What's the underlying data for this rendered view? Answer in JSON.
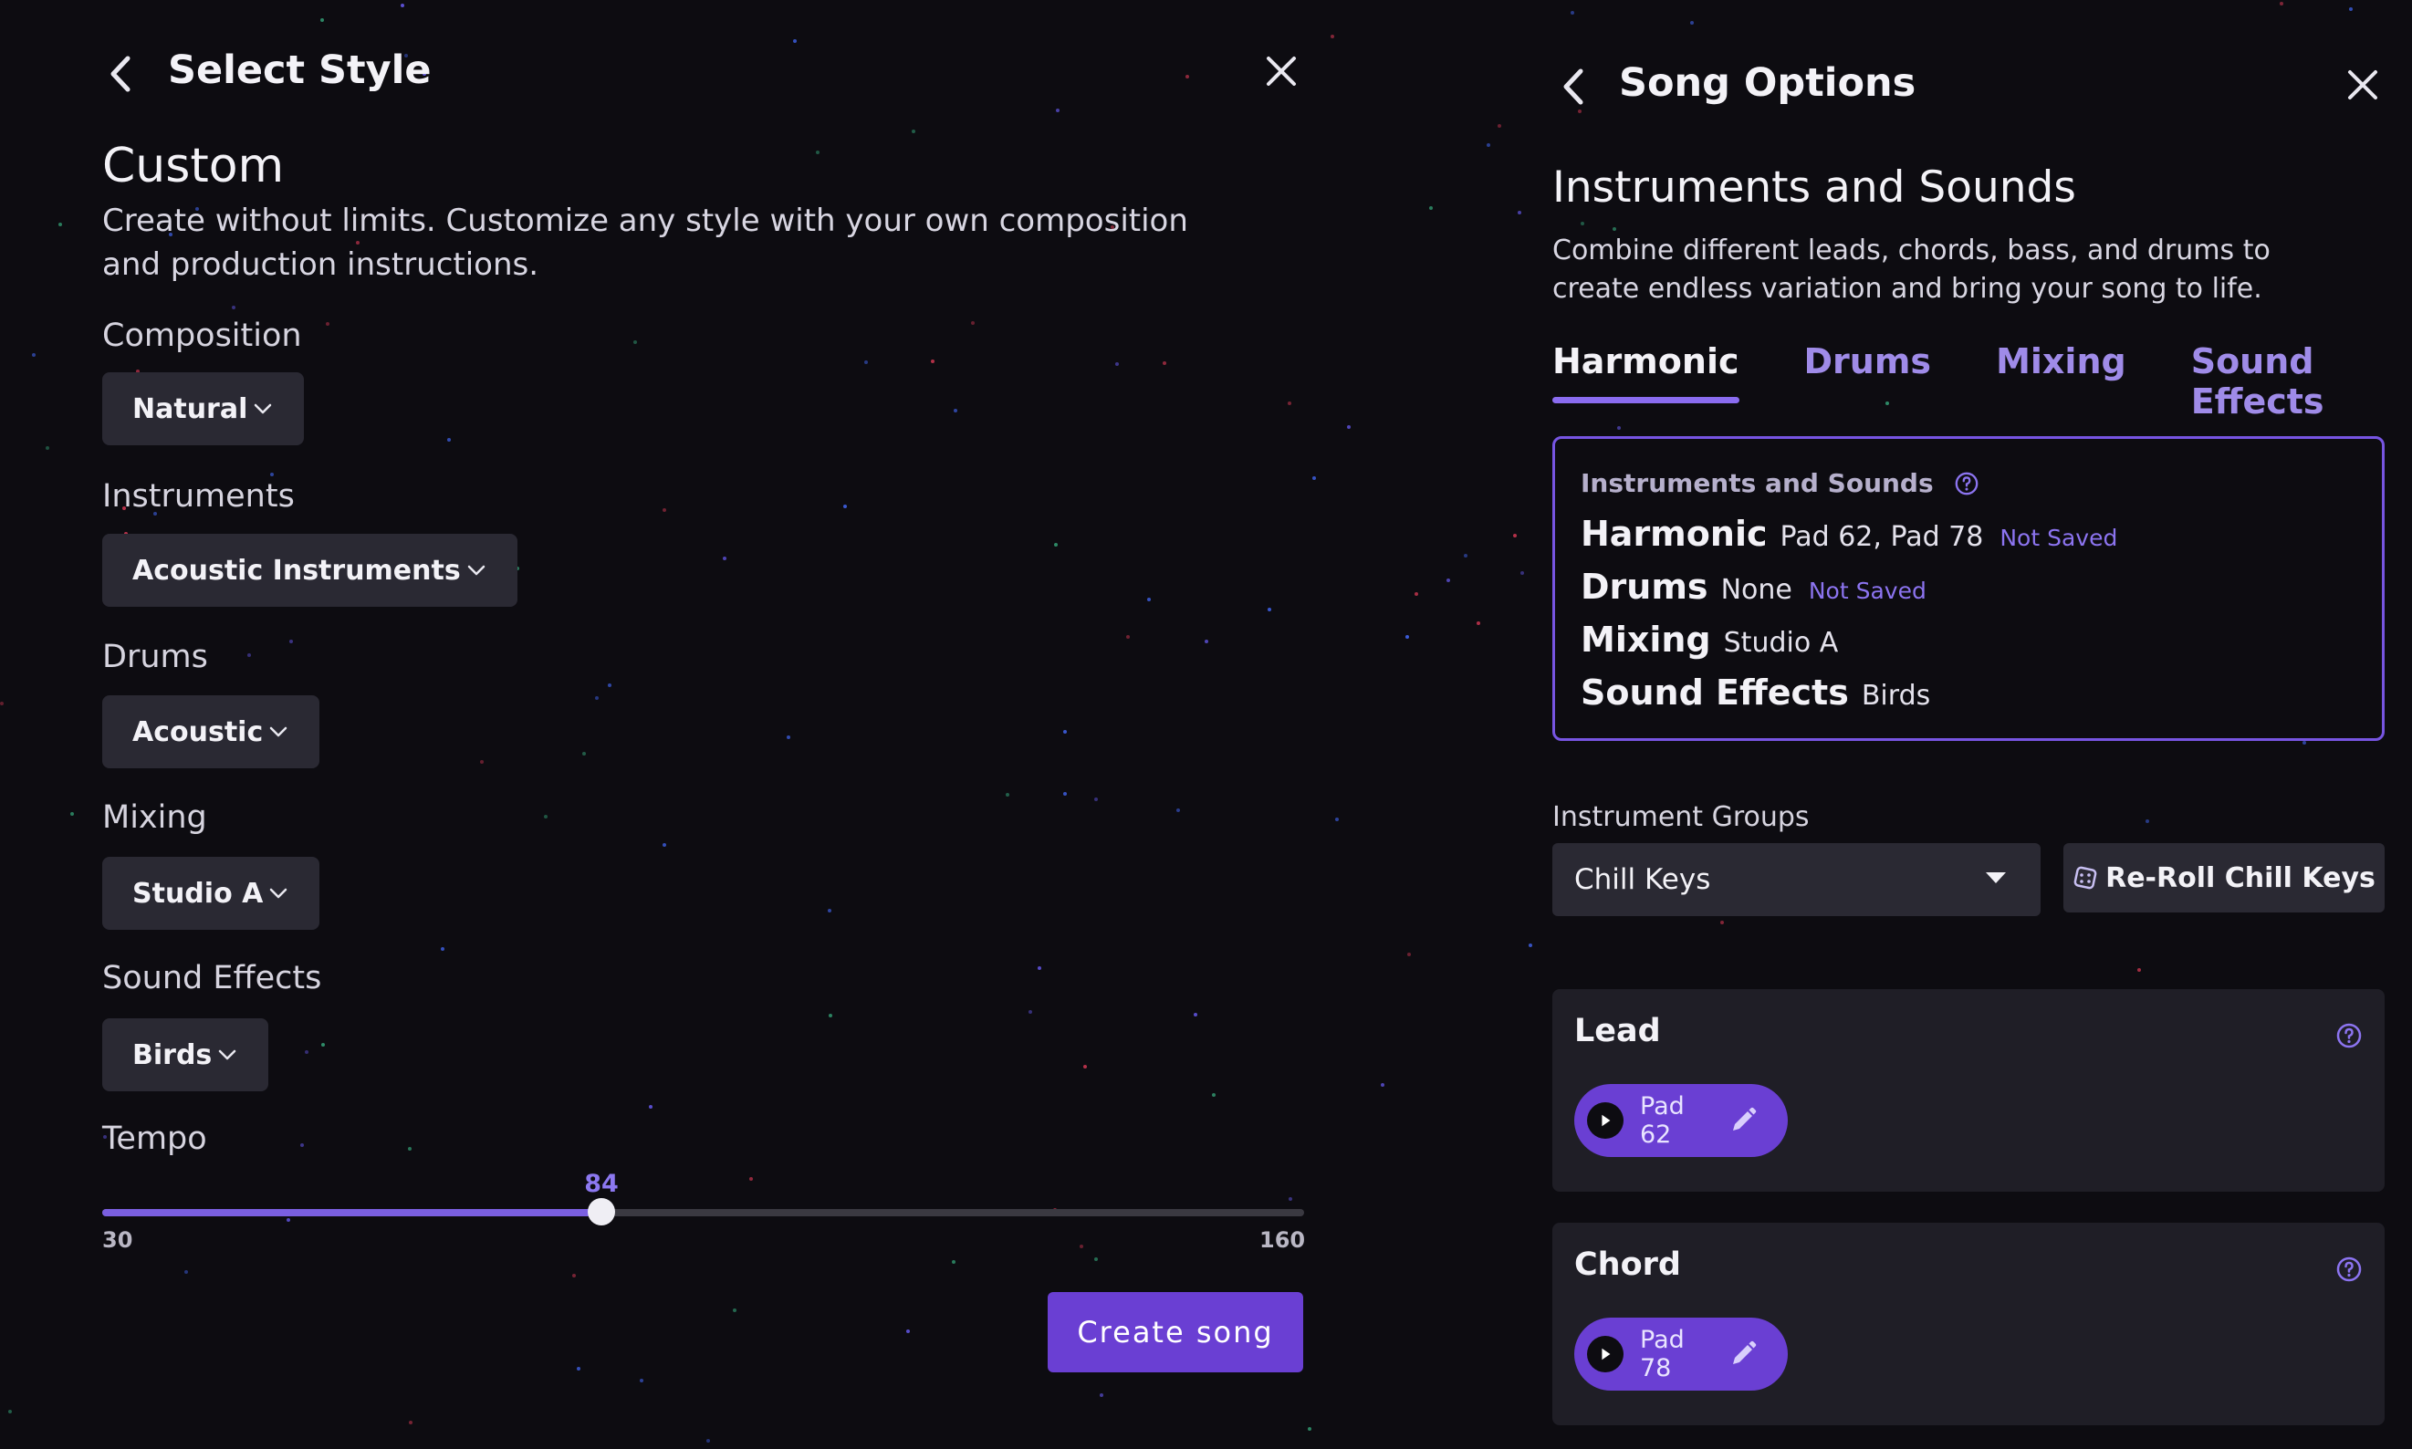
{
  "left_panel": {
    "title": "Select Style",
    "heading": "Custom",
    "description": "Create without limits. Customize any style with your own composition and production instructions.",
    "fields": {
      "composition": {
        "label": "Composition",
        "value": "Natural"
      },
      "instruments": {
        "label": "Instruments",
        "value": "Acoustic Instruments"
      },
      "drums": {
        "label": "Drums",
        "value": "Acoustic"
      },
      "mixing": {
        "label": "Mixing",
        "value": "Studio A"
      },
      "sound_effects": {
        "label": "Sound Effects",
        "value": "Birds"
      }
    },
    "tempo": {
      "label": "Tempo",
      "value": 84,
      "value_text": "84",
      "min": 30,
      "max": 160,
      "min_text": "30",
      "max_text": "160"
    },
    "create_button": "Create song"
  },
  "right_panel": {
    "title": "Song Options",
    "heading": "Instruments and Sounds",
    "description": "Combine different leads, chords, bass, and drums to create endless variation and bring your song to life.",
    "tabs": [
      {
        "label": "Harmonic",
        "active": true
      },
      {
        "label": "Drums",
        "active": false
      },
      {
        "label": "Mixing",
        "active": false
      },
      {
        "label": "Sound Effects",
        "active": false
      }
    ],
    "summary": {
      "heading": "Instruments and Sounds",
      "rows": [
        {
          "key": "Harmonic",
          "value": "Pad 62, Pad 78",
          "note": "Not Saved"
        },
        {
          "key": "Drums",
          "value": "None",
          "note": "Not Saved"
        },
        {
          "key": "Mixing",
          "value": "Studio A",
          "note": ""
        },
        {
          "key": "Sound Effects",
          "value": "Birds",
          "note": ""
        }
      ]
    },
    "instrument_groups": {
      "label": "Instrument Groups",
      "selected": "Chill Keys",
      "reroll_label": "Re-Roll Chill Keys"
    },
    "cards": [
      {
        "title": "Lead",
        "instrument": "Pad 62"
      },
      {
        "title": "Chord",
        "instrument": "Pad 78"
      }
    ]
  },
  "icons": {
    "back": "chevron-left-icon",
    "close": "close-icon",
    "dropdown": "chevron-down-icon",
    "help": "question-circle-icon",
    "play": "play-icon",
    "edit": "pencil-icon",
    "reroll": "dice-icon"
  },
  "colors": {
    "background": "#0d0c11",
    "accent": "#6a3fd3",
    "accent_light": "#8c74f0",
    "surface": "#2a2933",
    "card": "#1f1e26"
  }
}
